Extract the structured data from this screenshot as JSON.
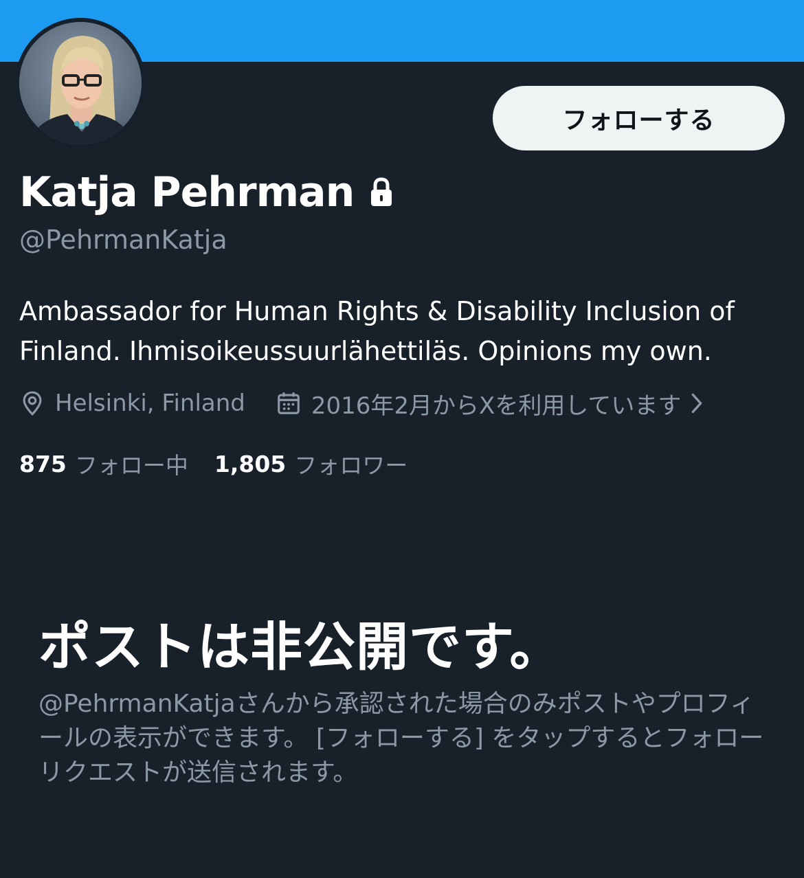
{
  "profile": {
    "display_name": "Katja Pehrman",
    "handle": "@PehrmanKatja",
    "bio": "Ambassador for Human Rights & Disability Inclusion of Finland. Ihmisoikeussuurlähettiläs. Opinions my own.",
    "location": "Helsinki, Finland",
    "joined": "2016年2月からXを利用しています",
    "protected_icon": "lock-icon",
    "location_icon": "map-pin-icon",
    "joined_icon": "calendar-icon"
  },
  "actions": {
    "follow_label": "フォローする"
  },
  "stats": {
    "following_count": "875",
    "following_label": "フォロー中",
    "followers_count": "1,805",
    "followers_label": "フォロワー"
  },
  "private_notice": {
    "title": "ポストは非公開です。",
    "description": "@PehrmanKatjaさんから承認された場合のみポストやプロフィールの表示ができます。 [フォローする] をタップするとフォローリクエストが送信されます。"
  },
  "colors": {
    "banner": "#1d9bf0",
    "background": "#18202a",
    "primary_text": "#ffffff",
    "secondary_text": "#8b98a5",
    "follow_button_bg": "#eff3f4"
  }
}
